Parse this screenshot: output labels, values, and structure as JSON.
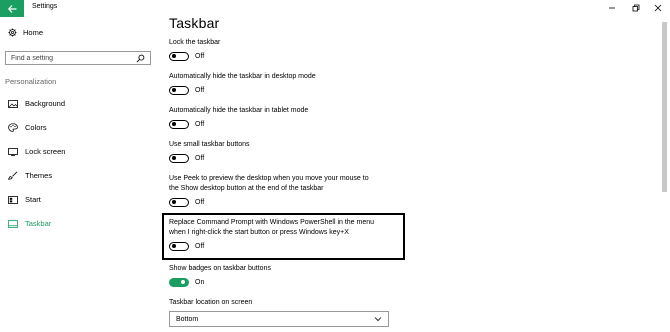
{
  "window": {
    "title": "Settings"
  },
  "sidebar": {
    "home_label": "Home",
    "search_placeholder": "Find a setting",
    "section_label": "Personalization",
    "items": [
      {
        "label": "Background",
        "icon": "picture-icon"
      },
      {
        "label": "Colors",
        "icon": "palette-icon"
      },
      {
        "label": "Lock screen",
        "icon": "lock-screen-icon"
      },
      {
        "label": "Themes",
        "icon": "brush-icon"
      },
      {
        "label": "Start",
        "icon": "start-icon"
      },
      {
        "label": "Taskbar",
        "icon": "taskbar-icon",
        "active": true
      }
    ]
  },
  "main": {
    "title": "Taskbar",
    "settings": [
      {
        "label_lines": [
          "Lock the taskbar"
        ],
        "state": "Off"
      },
      {
        "label_lines": [
          "Automatically hide the taskbar in desktop mode"
        ],
        "state": "Off"
      },
      {
        "label_lines": [
          "Automatically hide the taskbar in tablet mode"
        ],
        "state": "Off"
      },
      {
        "label_lines": [
          "Use small taskbar buttons"
        ],
        "state": "Off"
      },
      {
        "label_lines": [
          "Use Peek to preview the desktop when you move your mouse to",
          "the Show desktop button at the end of the taskbar"
        ],
        "state": "Off"
      },
      {
        "label_lines": [
          "Replace Command Prompt with Windows PowerShell in the menu",
          "when I right-click the start button or press Windows key+X"
        ],
        "state": "Off"
      },
      {
        "label_lines": [
          "Show badges on taskbar buttons"
        ],
        "state": "On"
      }
    ],
    "location_label": "Taskbar location on screen",
    "location_value": "Bottom"
  },
  "colors": {
    "accent": "#1a9e62"
  }
}
